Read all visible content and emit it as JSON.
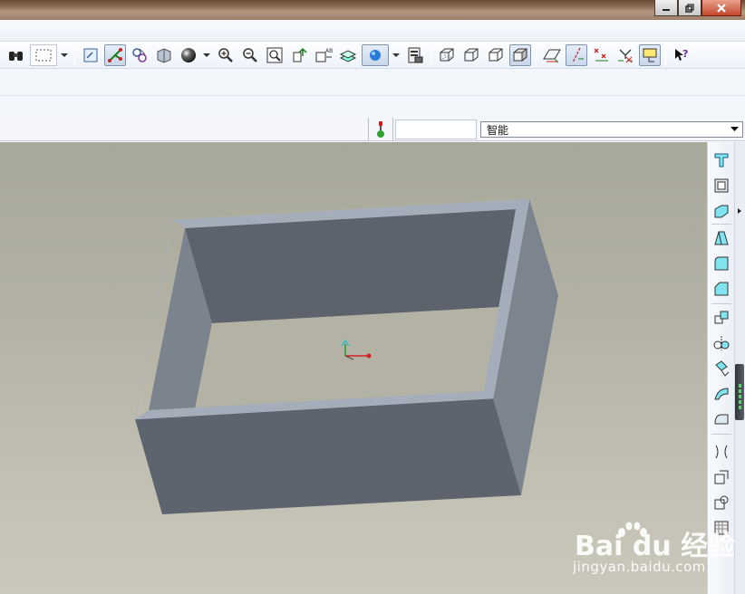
{
  "app": {
    "window_controls": [
      "minimize",
      "restore",
      "close"
    ]
  },
  "toolbar": {
    "buttons": [
      {
        "name": "find-icon",
        "active": false
      },
      {
        "name": "select-box-icon",
        "active": false
      },
      {
        "name": "repaint-icon",
        "active": false
      },
      {
        "name": "spin-center-icon",
        "active": true
      },
      {
        "name": "orient-mode-icon",
        "active": false
      },
      {
        "name": "view-manager-icon",
        "active": false
      },
      {
        "name": "shading-sphere-icon",
        "active": false
      },
      {
        "name": "zoom-in-icon",
        "active": false
      },
      {
        "name": "zoom-out-icon",
        "active": false
      },
      {
        "name": "refit-icon",
        "active": false
      },
      {
        "name": "saved-views-icon",
        "active": false
      },
      {
        "name": "named-views-icon",
        "active": false
      },
      {
        "name": "layers-icon",
        "active": false
      },
      {
        "name": "display-style-icon",
        "active": true
      },
      {
        "name": "appearance-icon",
        "active": false
      },
      {
        "name": "wireframe-icon",
        "active": false
      },
      {
        "name": "hidden-line-icon",
        "active": false
      },
      {
        "name": "no-hidden-icon",
        "active": false
      },
      {
        "name": "shaded-icon",
        "active": true
      },
      {
        "name": "datum-planes-icon",
        "active": false
      },
      {
        "name": "datum-axes-icon",
        "active": true
      },
      {
        "name": "datum-points-icon",
        "active": false
      },
      {
        "name": "csys-icon",
        "active": false
      },
      {
        "name": "annotation-icon",
        "active": true
      },
      {
        "name": "context-help-icon",
        "active": false
      }
    ]
  },
  "status": {
    "filter_value": "智能"
  },
  "right_toolbar": {
    "tools": [
      "hole-icon",
      "shell-icon",
      "rib-icon",
      "draft-icon",
      "round-icon",
      "chamfer-icon",
      "pattern-icon",
      "mirror-icon",
      "extrude-tool-icon",
      "sweep-icon",
      "blend-icon",
      "boundary-icon",
      "offset-icon",
      "thicken-icon",
      "solidify-icon"
    ]
  },
  "watermark": {
    "brand": "Bai du 经验",
    "url": "jingyan.baidu.com"
  },
  "colors": {
    "model_face_dark": "#5d636c",
    "model_face_side": "#7b838d",
    "model_edge_light": "#a3aeba",
    "viewport_bg_top": "#a8a89a",
    "viewport_bg_bottom": "#cac8ba"
  }
}
